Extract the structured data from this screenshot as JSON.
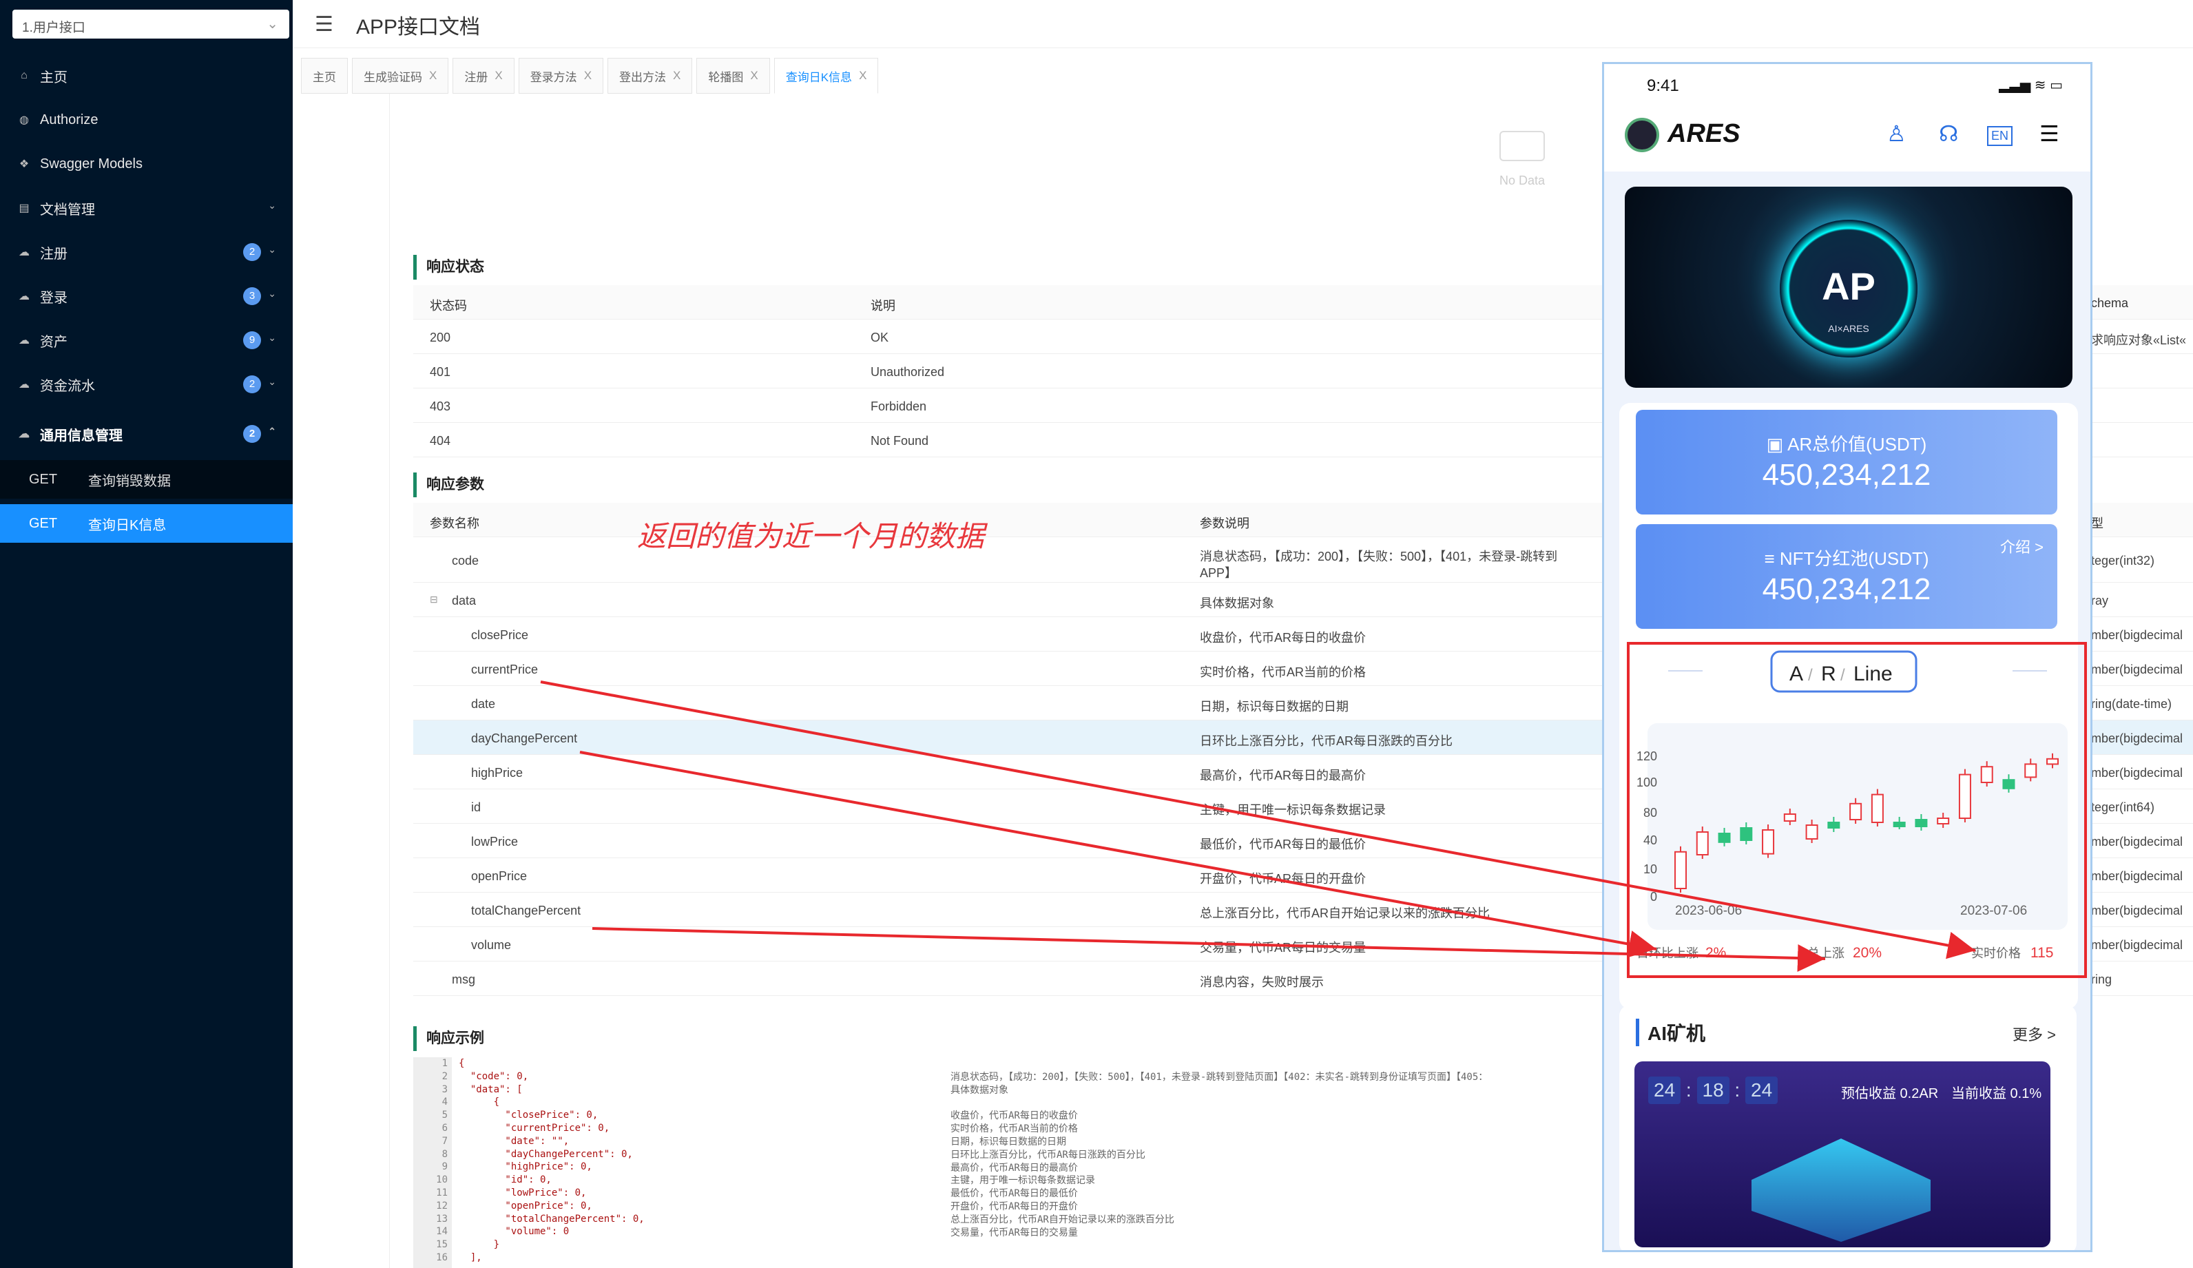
{
  "sidebar": {
    "select": "1.用户接口",
    "items": [
      {
        "icon": "home-icon",
        "label": "主页"
      },
      {
        "icon": "authorize-icon",
        "label": "Authorize"
      },
      {
        "icon": "models-icon",
        "label": "Swagger Models"
      },
      {
        "icon": "doc-icon",
        "label": "文档管理"
      },
      {
        "icon": "cloud-icon",
        "label": "注册",
        "badge": "2"
      },
      {
        "icon": "cloud-icon",
        "label": "登录",
        "badge": "3"
      },
      {
        "icon": "cloud-icon",
        "label": "资产",
        "badge": "9"
      },
      {
        "icon": "cloud-icon",
        "label": "资金流水",
        "badge": "2"
      },
      {
        "icon": "cloud-icon",
        "label": "通用信息管理",
        "badge": "2"
      }
    ],
    "subs": [
      {
        "method": "GET",
        "label": "查询销毁数据"
      },
      {
        "method": "GET",
        "label": "查询日K信息"
      }
    ]
  },
  "header": {
    "title": "APP接口文档"
  },
  "tabs": [
    "主页",
    "生成验证码",
    "注册",
    "登录方法",
    "登出方法",
    "轮播图",
    "查询日K信息"
  ],
  "no_data": "No Data",
  "response_status": {
    "title": "响应状态",
    "headers": [
      "状态码",
      "说明",
      "chema"
    ],
    "rows": [
      [
        "200",
        "OK",
        "求响应对象«List«"
      ],
      [
        "401",
        "Unauthorized",
        ""
      ],
      [
        "403",
        "Forbidden",
        ""
      ],
      [
        "404",
        "Not Found",
        ""
      ]
    ]
  },
  "response_params": {
    "title": "响应参数",
    "headers": [
      "参数名称",
      "参数说明",
      "型"
    ],
    "rows": [
      [
        "code",
        "消息状态码，【成功：200】，【失败：500】，【401，未登录-跳转到",
        "APP】",
        "teger(int32)"
      ],
      [
        "data",
        "具体数据对象",
        "",
        "ray"
      ],
      [
        "closePrice",
        "收盘价，代币AR每日的收盘价",
        "",
        "mber(bigdecimal"
      ],
      [
        "currentPrice",
        "实时价格，代币AR当前的价格",
        "",
        "mber(bigdecimal"
      ],
      [
        "date",
        "日期，标识每日数据的日期",
        "",
        "ring(date-time)"
      ],
      [
        "dayChangePercent",
        "日环比上涨百分比，代币AR每日涨跌的百分比",
        "",
        "mber(bigdecimal"
      ],
      [
        "highPrice",
        "最高价，代币AR每日的最高价",
        "",
        "mber(bigdecimal"
      ],
      [
        "id",
        "主键，用于唯一标识每条数据记录",
        "",
        "teger(int64)"
      ],
      [
        "lowPrice",
        "最低价，代币AR每日的最低价",
        "",
        "mber(bigdecimal"
      ],
      [
        "openPrice",
        "开盘价，代币AR每日的开盘价",
        "",
        "mber(bigdecimal"
      ],
      [
        "totalChangePercent",
        "总上涨百分比，代币AR自开始记录以来的涨跌百分比",
        "",
        "mber(bigdecimal"
      ],
      [
        "volume",
        "交易量，代币AR每日的交易量",
        "",
        "mber(bigdecimal"
      ],
      [
        "msg",
        "消息内容，失败时展示",
        "",
        "ring"
      ]
    ]
  },
  "annotation": "返回的值为近一个月的数据",
  "response_example": {
    "title": "响应示例",
    "lines": [
      "1",
      "2",
      "3",
      "4",
      "5",
      "6",
      "7",
      "8",
      "9",
      "10",
      "11",
      "12",
      "13",
      "14",
      "15",
      "16"
    ],
    "code": "{\n  \"code\": 0,\n  \"data\": [\n      {\n        \"closePrice\": 0,\n        \"currentPrice\": 0,\n        \"date\": \"\",\n        \"dayChangePercent\": 0,\n        \"highPrice\": 0,\n        \"id\": 0,\n        \"lowPrice\": 0,\n        \"openPrice\": 0,\n        \"totalChangePercent\": 0,\n        \"volume\": 0\n      }\n  ],",
    "desc": "消息状态码，【成功：200】，【失败：500】，【401，未登录-跳转到登陆页面】【402：未实名-跳转到身份证填写页面】【405：\n具体数据对象\n\n收盘价，代币AR每日的收盘价\n实时价格，代币AR当前的价格\n日期，标识每日数据的日期\n日环比上涨百分比，代币AR每日涨跌的百分比\n最高价，代币AR每日的最高价\n主键，用于唯一标识每条数据记录\n最低价，代币AR每日的最低价\n开盘价，代币AR每日的开盘价\n总上涨百分比，代币AR自开始记录以来的涨跌百分比\n交易量，代币AR每日的交易量"
  },
  "phone": {
    "time": "9:41",
    "brand": "ARES",
    "banner_title": "AP",
    "banner_label": "AI×ARES",
    "lang": "EN",
    "card1_label": "AR总价值(USDT)",
    "card1_value": "450,234,212",
    "card2_label": "NFT分红池(USDT)",
    "card2_value": "450,234,212",
    "card2_intro": "介绍 >",
    "chart_title": [
      "A",
      "R",
      "Line"
    ],
    "chart_axis_labels": [
      "120",
      "100",
      "80",
      "40",
      "10",
      "0"
    ],
    "x_start": "2023-06-06",
    "x_end": "2023-07-06",
    "day_label": "日环比上涨",
    "day_value": "2%",
    "total_label": "总上涨",
    "total_value": "20%",
    "current_label": "实时价格",
    "current_value": "115",
    "ai_title": "AI矿机",
    "ai_more": "更多 >",
    "timer": [
      "24",
      "18",
      "24"
    ],
    "yield1": "预估收益 0.2AR",
    "yield2": "当前收益 0.1%"
  },
  "chart_data": {
    "type": "candlestick",
    "x_range": [
      "2023-06-06",
      "2023-07-06"
    ],
    "y_ticks": [
      "0",
      "10",
      "40",
      "80",
      "100",
      "120"
    ],
    "candles": [
      {
        "open": 3,
        "close": 28,
        "up": false
      },
      {
        "open": 25,
        "close": 52,
        "up": false
      },
      {
        "open": 50,
        "close": 38,
        "up": true
      },
      {
        "open": 40,
        "close": 58,
        "up": true
      },
      {
        "open": 55,
        "close": 26,
        "up": false
      },
      {
        "open": 68,
        "close": 78,
        "up": false
      },
      {
        "open": 62,
        "close": 42,
        "up": false
      },
      {
        "open": 66,
        "close": 58,
        "up": true
      },
      {
        "open": 70,
        "close": 86,
        "up": false
      },
      {
        "open": 66,
        "close": 92,
        "up": false
      },
      {
        "open": 66,
        "close": 62,
        "up": true
      },
      {
        "open": 70,
        "close": 60,
        "up": true
      },
      {
        "open": 64,
        "close": 72,
        "up": false
      },
      {
        "open": 72,
        "close": 106,
        "up": false
      },
      {
        "open": 100,
        "close": 112,
        "up": false
      },
      {
        "open": 96,
        "close": 102,
        "up": true
      },
      {
        "open": 104,
        "close": 114,
        "up": false
      },
      {
        "open": 114,
        "close": 118,
        "up": false
      }
    ],
    "colors": {
      "up": "#2ec27e",
      "down": "#e8383d"
    }
  },
  "colors": {
    "sidebar": "#001529",
    "accent": "#1890ff",
    "annotation": "#e8383d"
  }
}
